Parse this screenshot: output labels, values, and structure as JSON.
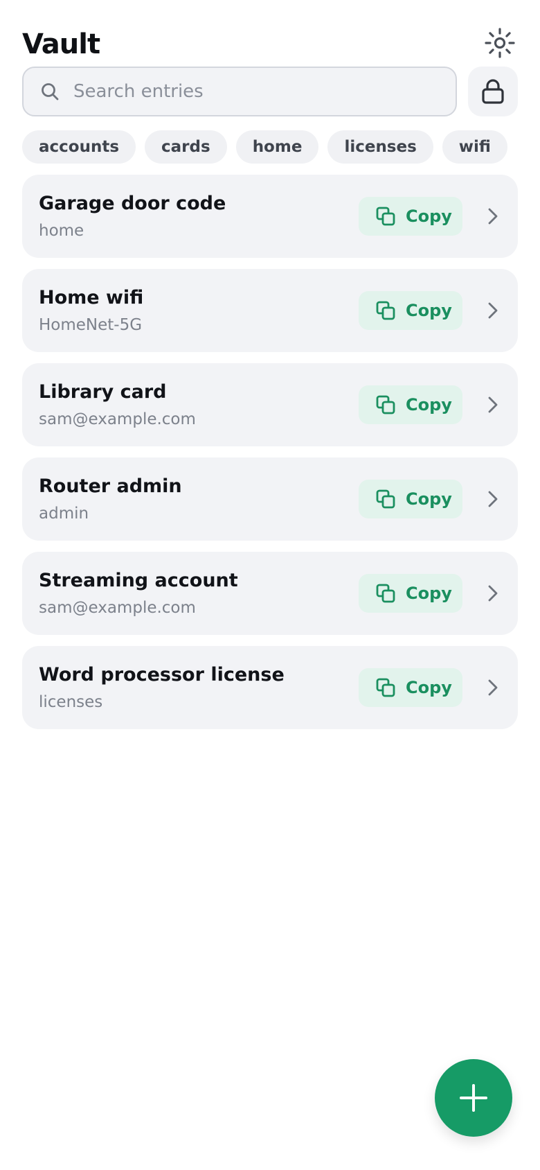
{
  "header": {
    "title": "Vault",
    "theme_icon": "sun-icon"
  },
  "search": {
    "placeholder": "Search entries",
    "value": "",
    "icon": "search-icon"
  },
  "lock": {
    "icon": "lock-icon"
  },
  "chips": [
    {
      "label": "accounts"
    },
    {
      "label": "cards"
    },
    {
      "label": "home"
    },
    {
      "label": "licenses"
    },
    {
      "label": "wifi"
    }
  ],
  "entries": [
    {
      "name": "Garage door code",
      "subtitle": "home",
      "copy_label": "Copy"
    },
    {
      "name": "Home wifi",
      "subtitle": "HomeNet-5G",
      "copy_label": "Copy"
    },
    {
      "name": "Library card",
      "subtitle": "sam@example.com",
      "copy_label": "Copy"
    },
    {
      "name": "Router admin",
      "subtitle": "admin",
      "copy_label": "Copy"
    },
    {
      "name": "Streaming account",
      "subtitle": "sam@example.com",
      "copy_label": "Copy"
    },
    {
      "name": "Word processor license",
      "subtitle": "licenses",
      "copy_label": "Copy"
    }
  ],
  "fab": {
    "icon": "plus-icon"
  },
  "colors": {
    "accent": "#169b66",
    "accent_text": "#1a8f5f",
    "accent_bg": "#e2f3ec",
    "card_bg": "#f2f3f6"
  }
}
